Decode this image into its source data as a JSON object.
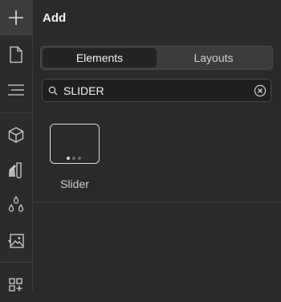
{
  "rail": {
    "items": [
      {
        "icon": "plus-icon",
        "active": true
      },
      {
        "icon": "page-icon"
      },
      {
        "icon": "navigator-icon"
      },
      {
        "icon": "box-icon"
      },
      {
        "icon": "paint-icon"
      },
      {
        "icon": "droplets-icon"
      },
      {
        "icon": "image-icon"
      },
      {
        "icon": "components-icon"
      }
    ]
  },
  "panel": {
    "title": "Add",
    "tabs": [
      {
        "label": "Elements",
        "active": true
      },
      {
        "label": "Layouts",
        "active": false
      }
    ],
    "search": {
      "value": "SLIDER",
      "placeholder": ""
    },
    "results": [
      {
        "label": "Slider",
        "icon": "slider-icon"
      }
    ]
  },
  "colors": {
    "background": "#2a2a2a",
    "rail_active": "#3d3d3d",
    "input_bg": "#1f1f1f"
  }
}
